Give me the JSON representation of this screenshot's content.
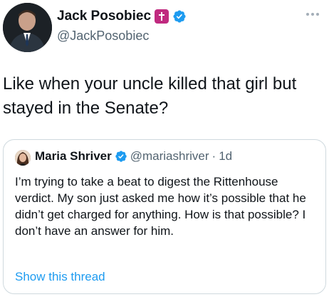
{
  "author": {
    "name": "Jack Posobiec",
    "handle": "@JackPosobiec",
    "badges": [
      "cross-badge",
      "verified-icon"
    ]
  },
  "more_icon": "more-icon",
  "tweet_text": "Like when your uncle killed that girl but stayed in the Senate?",
  "quote": {
    "name": "Maria Shriver",
    "handle": "@mariashriver",
    "separator": "·",
    "time": "1d",
    "text": "I’m trying to take a beat to digest the Rittenhouse verdict. My son just asked me how it’s possible that he didn’t get charged for anything. How is that possible? I don’t have an answer for him.",
    "show_thread_label": "Show this thread"
  },
  "colors": {
    "verified": "#1d9bf0",
    "cross_badge": "#c02a7f",
    "link": "#1d9bf0",
    "secondary_text": "#536471",
    "border": "#cfd9de"
  }
}
